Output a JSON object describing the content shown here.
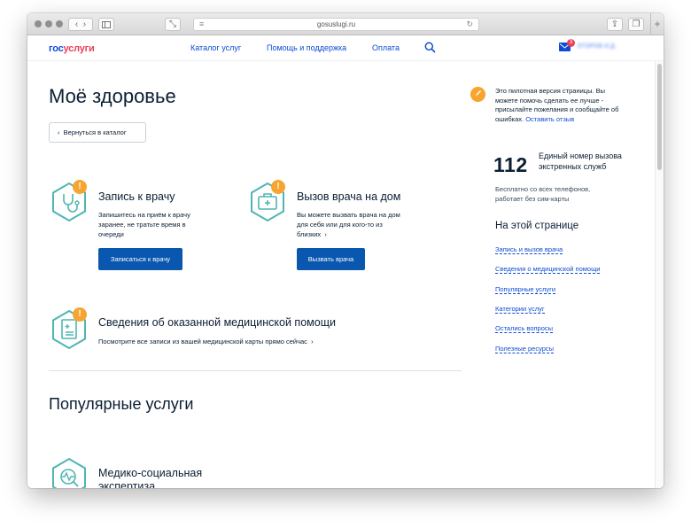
{
  "browser": {
    "address": "gosuslugi.ru",
    "tab_plus": "+"
  },
  "header": {
    "logo_gos": "гос",
    "logo_uslugi": "услуги",
    "nav": [
      "Каталог услуг",
      "Помощь и поддержка",
      "Оплата"
    ],
    "mail_count": "3",
    "user_name": "ЕГОРОВ И.Д."
  },
  "main": {
    "title": "Моё здоровье",
    "back_label": "Вернуться в каталог",
    "services": [
      {
        "title": "Запись к врачу",
        "desc": [
          "Запишитесь на приём к врачу",
          "заранее, не тратьте время в",
          "очереди"
        ],
        "button": "Записаться к врачу",
        "icon": "stethoscope-icon"
      },
      {
        "title": "Вызов врача на дом",
        "desc": [
          "Вы можете вызвать врача на дом",
          "для себя или для кого-то из",
          "близких"
        ],
        "button": "Вызвать врача",
        "icon": "medical-kit-icon"
      },
      {
        "title": "Сведения об оказанной медицинской помощи",
        "desc": [
          "Посмотрите все записи из вашей медицинской карты прямо сейчас"
        ],
        "icon": "medical-record-icon"
      }
    ],
    "alert_mark": "!",
    "popular_title": "Популярные услуги",
    "popular_items": [
      {
        "title_lines": [
          "Медико-социальная",
          "экспертиза"
        ],
        "icon": "medical-exam-icon"
      }
    ]
  },
  "sidebar": {
    "pilot_note": "Это пилотная версия страницы. Вы можете помочь сделать ее лучше - присылайте пожелания и сообщайте об ошибках.",
    "pilot_link": "Оставить отзыв",
    "emergency_number": "112",
    "emergency_label": "Единый номер вызова экстренных служб",
    "emergency_note": "Бесплатно со всех телефонов, работает без сим-карты",
    "toc_title": "На этой странице",
    "toc": [
      "Запись и вызов врача",
      "Сведения о медицинской помощи",
      "Популярные услуги",
      "Категории услуг",
      "Остались вопросы",
      "Полезные ресурсы"
    ]
  },
  "colors": {
    "brand_blue": "#0d4cd3",
    "brand_red": "#ee3f58",
    "button": "#0a57b0",
    "teal_icon": "#4fb5b3",
    "alert": "#f7a530"
  }
}
